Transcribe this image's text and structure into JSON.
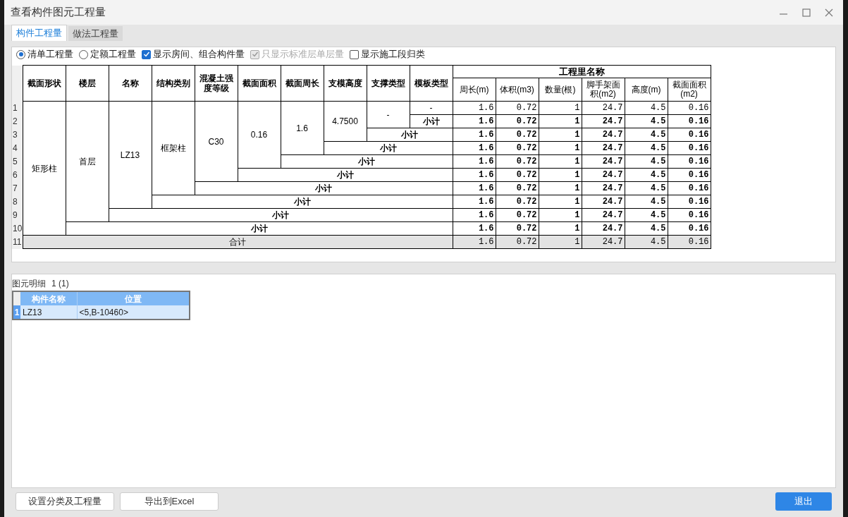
{
  "window": {
    "title": "查看构件图元工程量"
  },
  "tabs": [
    {
      "label": "构件工程量",
      "selected": true
    },
    {
      "label": "做法工程量",
      "selected": false
    }
  ],
  "options": [
    {
      "kind": "radio",
      "label": "清单工程量",
      "checked": true,
      "disabled": false
    },
    {
      "kind": "radio",
      "label": "定额工程量",
      "checked": false,
      "disabled": false
    },
    {
      "kind": "checkbox",
      "label": "显示房间、组合构件量",
      "checked": true,
      "disabled": false
    },
    {
      "kind": "checkbox",
      "label": "只显示标准层单层量",
      "checked": true,
      "disabled": true
    },
    {
      "kind": "checkbox",
      "label": "显示施工段归类",
      "checked": false,
      "disabled": false
    }
  ],
  "quantity_table": {
    "columns": [
      "截面形状",
      "楼层",
      "名称",
      "结构类别",
      "混凝土强度等级",
      "截面面积",
      "截面周长",
      "支模高度",
      "支撑类型",
      "模板类型"
    ],
    "group_header": "工程里名称",
    "quantity_columns": [
      "周长(m)",
      "体积(m3)",
      "数量(根)",
      "脚手架面积(m2)",
      "高度(m)",
      "截面面积(m2)"
    ],
    "rows": [
      {
        "number": "1",
        "kind": "item",
        "cells": [
          {
            "text": "矩形柱",
            "rowspan": 10
          },
          {
            "text": "首层",
            "rowspan": 9
          },
          {
            "text": "LZ13",
            "rowspan": 8
          },
          {
            "text": "框架柱",
            "rowspan": 7
          },
          {
            "text": "C30",
            "rowspan": 6
          },
          {
            "text": "0.16",
            "rowspan": 5
          },
          {
            "text": "1.6",
            "rowspan": 4
          },
          {
            "text": "4.7500",
            "rowspan": 3
          },
          {
            "text": "-",
            "rowspan": 2
          },
          {
            "text": "-"
          }
        ],
        "values": [
          "1.6",
          "0.72",
          "1",
          "24.7",
          "4.5",
          "0.16"
        ]
      },
      {
        "number": "2",
        "kind": "subtotal",
        "cells": [
          {
            "text": "小计"
          }
        ],
        "values": [
          "1.6",
          "0.72",
          "1",
          "24.7",
          "4.5",
          "0.16"
        ]
      },
      {
        "number": "3",
        "kind": "subtotal",
        "cells": [
          {
            "text": "小计",
            "colspan": 2
          }
        ],
        "values": [
          "1.6",
          "0.72",
          "1",
          "24.7",
          "4.5",
          "0.16"
        ]
      },
      {
        "number": "4",
        "kind": "subtotal",
        "cells": [
          {
            "text": "小计",
            "colspan": 3
          }
        ],
        "values": [
          "1.6",
          "0.72",
          "1",
          "24.7",
          "4.5",
          "0.16"
        ]
      },
      {
        "number": "5",
        "kind": "subtotal",
        "cells": [
          {
            "text": "小计",
            "colspan": 4
          }
        ],
        "values": [
          "1.6",
          "0.72",
          "1",
          "24.7",
          "4.5",
          "0.16"
        ]
      },
      {
        "number": "6",
        "kind": "subtotal",
        "cells": [
          {
            "text": "小计",
            "colspan": 5
          }
        ],
        "values": [
          "1.6",
          "0.72",
          "1",
          "24.7",
          "4.5",
          "0.16"
        ]
      },
      {
        "number": "7",
        "kind": "subtotal",
        "cells": [
          {
            "text": "小计",
            "colspan": 6
          }
        ],
        "values": [
          "1.6",
          "0.72",
          "1",
          "24.7",
          "4.5",
          "0.16"
        ]
      },
      {
        "number": "8",
        "kind": "subtotal",
        "cells": [
          {
            "text": "小计",
            "colspan": 7
          }
        ],
        "values": [
          "1.6",
          "0.72",
          "1",
          "24.7",
          "4.5",
          "0.16"
        ]
      },
      {
        "number": "9",
        "kind": "subtotal",
        "cells": [
          {
            "text": "小计",
            "colspan": 8
          }
        ],
        "values": [
          "1.6",
          "0.72",
          "1",
          "24.7",
          "4.5",
          "0.16"
        ]
      },
      {
        "number": "10",
        "kind": "subtotal",
        "cells": [
          {
            "text": "小计",
            "colspan": 9
          }
        ],
        "values": [
          "1.6",
          "0.72",
          "1",
          "24.7",
          "4.5",
          "0.16"
        ]
      },
      {
        "number": "11",
        "kind": "total",
        "cells": [
          {
            "text": "合计",
            "colspan": 10
          }
        ],
        "values": [
          "1.6",
          "0.72",
          "1",
          "24.7",
          "4.5",
          "0.16"
        ]
      }
    ]
  },
  "detail": {
    "title": "图元明细",
    "count": "1 (1)",
    "columns": [
      "构件名称",
      "位置"
    ],
    "rows": [
      {
        "number": "1",
        "cells": [
          "LZ13",
          "<5,B-10460>"
        ]
      }
    ]
  },
  "buttons": [
    {
      "kind": "plain",
      "label": "设置分类及工程量"
    },
    {
      "kind": "plain",
      "label": "导出到Excel"
    },
    {
      "kind": "primary",
      "label": "退出"
    }
  ]
}
